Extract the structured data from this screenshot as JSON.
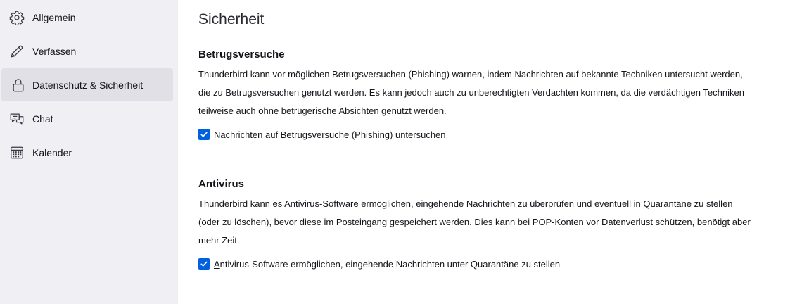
{
  "sidebar": {
    "items": [
      {
        "label": "Allgemein",
        "icon": "gear-icon"
      },
      {
        "label": "Verfassen",
        "icon": "pencil-icon"
      },
      {
        "label": "Datenschutz & Sicherheit",
        "icon": "lock-icon",
        "selected": true
      },
      {
        "label": "Chat",
        "icon": "chat-bubbles-icon"
      },
      {
        "label": "Kalender",
        "icon": "calendar-icon"
      }
    ]
  },
  "main": {
    "title": "Sicherheit",
    "sections": [
      {
        "heading": "Betrugsversuche",
        "description": "Thunderbird kann vor möglichen Betrugsversuchen (Phishing) warnen, indem Nachrichten auf bekannte Techniken untersucht werden, die zu Betrugsversuchen genutzt werden. Es kann jedoch auch zu unberechtigten Verdachten kommen, da die verdächtigen Techniken teilweise auch ohne betrügerische Absichten genutzt werden.",
        "checkbox": {
          "access_key": "N",
          "label_rest": "achrichten auf Betrugsversuche (Phishing) untersuchen",
          "checked": true
        }
      },
      {
        "heading": "Antivirus",
        "description": "Thunderbird kann es Antivirus-Software ermöglichen, eingehende Nachrichten zu überprüfen und eventuell in Quarantäne zu stellen (oder zu löschen), bevor diese im Posteingang gespeichert werden. Dies kann bei POP-Konten vor Datenverlust schützen, benötigt aber mehr Zeit.",
        "checkbox": {
          "access_key": "A",
          "label_rest": "ntivirus-Software ermöglichen, eingehende Nachrichten unter Quarantäne zu stellen",
          "checked": true
        }
      }
    ]
  },
  "colors": {
    "sidebar_bg": "#f0f0f4",
    "selected_bg": "#e0e0e6",
    "checkbox_accent": "#0061e0"
  }
}
